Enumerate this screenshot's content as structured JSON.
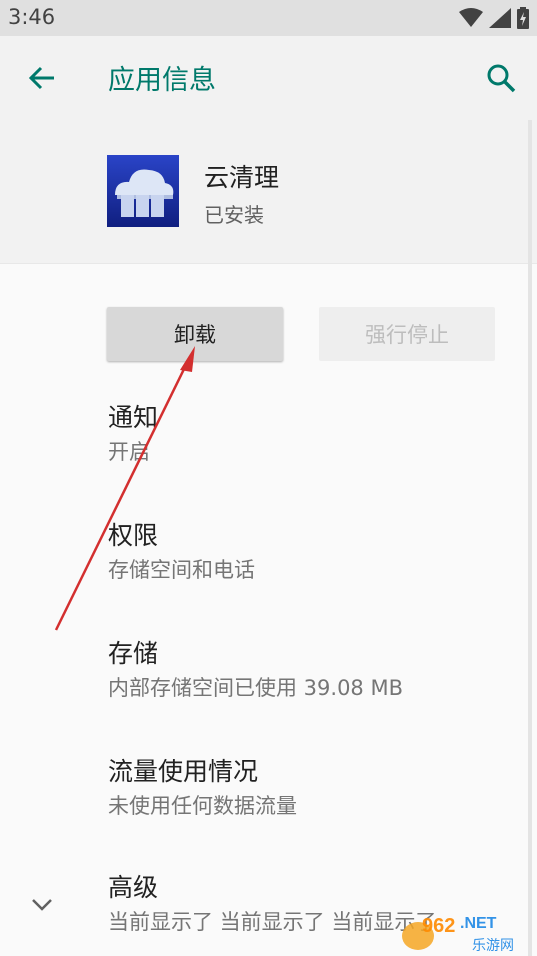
{
  "status_bar": {
    "time": "3:46",
    "icons": [
      "wifi-icon",
      "signal-icon",
      "battery-icon"
    ]
  },
  "app_bar": {
    "title": "应用信息",
    "back_icon": "arrow-left-icon",
    "search_icon": "search-icon"
  },
  "app_header": {
    "name": "云清理",
    "status": "已安装",
    "icon": "cloud-cleaner-app-icon"
  },
  "buttons": {
    "uninstall": "卸载",
    "force_stop": "强行停止"
  },
  "settings": [
    {
      "title": "通知",
      "subtitle": "开启"
    },
    {
      "title": "权限",
      "subtitle": "存储空间和电话"
    },
    {
      "title": "存储",
      "subtitle": "内部存储空间已使用 39.08 MB"
    },
    {
      "title": "流量使用情况",
      "subtitle": "未使用任何数据流量"
    },
    {
      "title": "高级",
      "subtitle": "当前显示了 当前显示了 当前显示了"
    }
  ],
  "watermark": {
    "line1": "962.NET",
    "line2": "乐游网"
  },
  "colors": {
    "accent": "#00796b",
    "annotation_arrow": "#d32f2f"
  }
}
